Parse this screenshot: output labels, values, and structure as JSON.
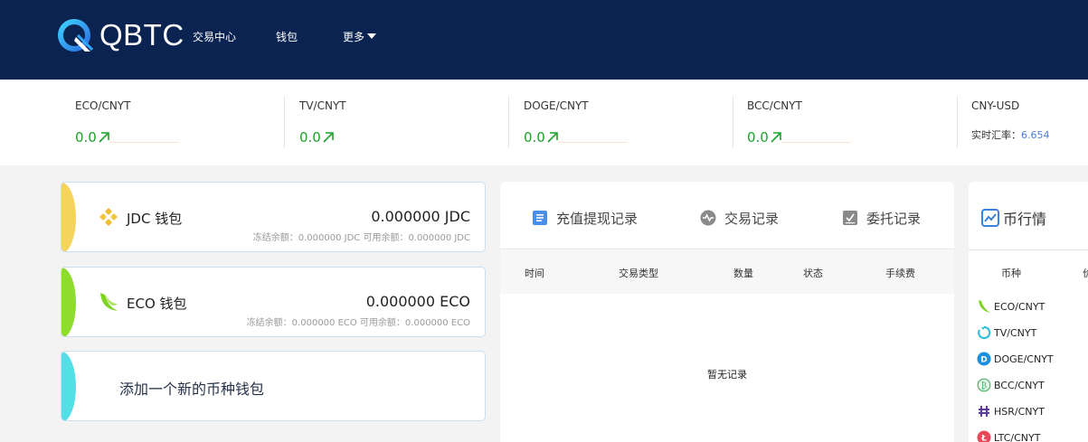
{
  "header": {
    "brand": "QBTC",
    "nav": [
      {
        "label": "交易中心"
      },
      {
        "label": "钱包"
      },
      {
        "label": "更多"
      }
    ]
  },
  "ticker": [
    {
      "pair": "ECO/CNYT",
      "price": "0.0"
    },
    {
      "pair": "TV/CNYT",
      "price": "0.0"
    },
    {
      "pair": "DOGE/CNYT",
      "price": "0.0"
    },
    {
      "pair": "BCC/CNYT",
      "price": "0.0"
    }
  ],
  "fx": {
    "pair": "CNY-USD",
    "label": "实时汇率：",
    "value": "6.654"
  },
  "wallets": [
    {
      "name": "JDC 钱包",
      "balance": "0.000000 JDC",
      "sub": "冻结余额：0.000000 JDC  可用余额：0.000000 JDC",
      "color": "#f6d35a"
    },
    {
      "name": "ECO 钱包",
      "balance": "0.000000 ECO",
      "sub": "冻结余额：0.000000 ECO  可用余额：0.000000 ECO",
      "color": "#8edc2c"
    }
  ],
  "add_wallet": {
    "label": "添加一个新的币种钱包",
    "color": "#52e0e6"
  },
  "records": {
    "tabs": [
      {
        "label": "充值提现记录",
        "icon": "document-icon"
      },
      {
        "label": "交易记录",
        "icon": "wave-icon"
      },
      {
        "label": "委托记录",
        "icon": "checklist-icon"
      }
    ],
    "columns": [
      "时间",
      "交易类型",
      "数量",
      "状态",
      "手续费"
    ],
    "empty": "暂无记录"
  },
  "market": {
    "title": "币行情",
    "col_coin": "币种",
    "col_partial": "价",
    "rows": [
      {
        "pair": "ECO/CNYT",
        "icon": "eco-icon"
      },
      {
        "pair": "TV/CNYT",
        "icon": "tv-icon"
      },
      {
        "pair": "DOGE/CNYT",
        "icon": "doge-icon"
      },
      {
        "pair": "BCC/CNYT",
        "icon": "bcc-icon"
      },
      {
        "pair": "HSR/CNYT",
        "icon": "hsr-icon"
      },
      {
        "pair": "LTC/CNYT",
        "icon": "ltc-icon"
      }
    ]
  },
  "colors": {
    "header_bg": "#0b2350",
    "up_green": "#1aa32a",
    "accent_blue": "#4a7fd0"
  }
}
